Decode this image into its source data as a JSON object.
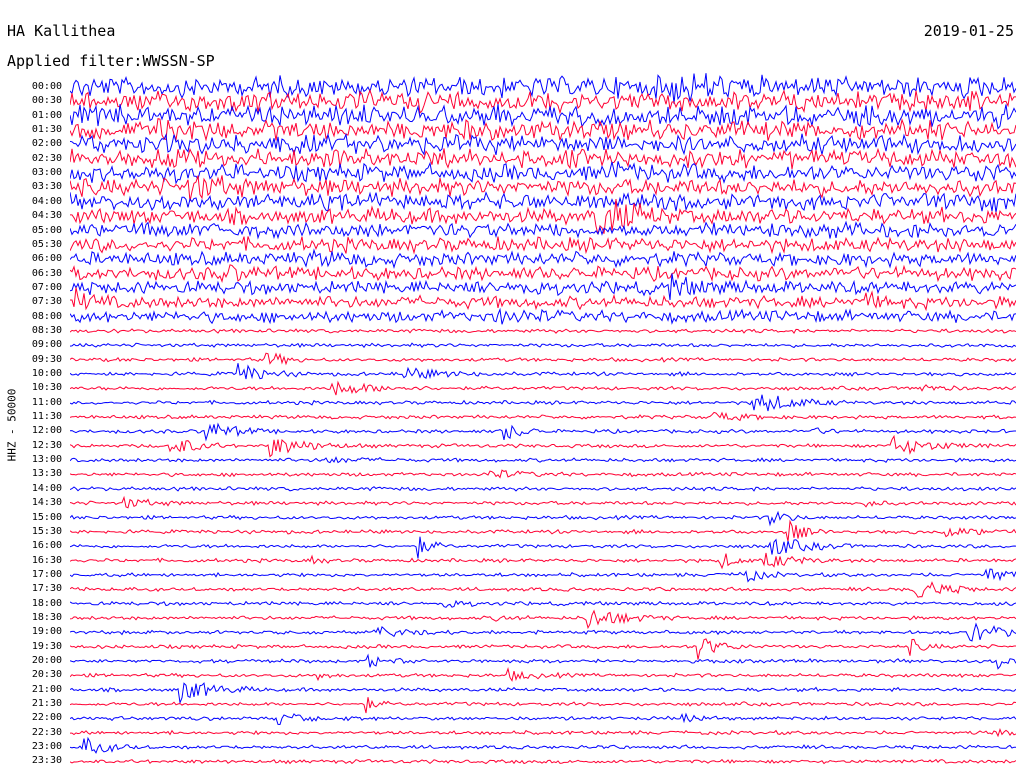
{
  "header": {
    "station": "HA Kallithea",
    "filter": "Applied filter:WWSSN-SP",
    "date": "2019-01-25"
  },
  "axis_label": "HHZ - 50000",
  "hours": [
    "00:00",
    "00:30",
    "01:00",
    "01:30",
    "02:00",
    "02:30",
    "03:00",
    "03:30",
    "04:00",
    "04:30",
    "05:00",
    "05:30",
    "06:00",
    "06:30",
    "07:00",
    "07:30",
    "08:00",
    "08:30",
    "09:00",
    "09:30",
    "10:00",
    "10:30",
    "11:00",
    "11:30",
    "12:00",
    "12:30",
    "13:00",
    "13:30",
    "14:00",
    "14:30",
    "15:00",
    "15:30",
    "16:00",
    "16:30",
    "17:00",
    "17:30",
    "18:00",
    "18:30",
    "19:00",
    "19:30",
    "20:00",
    "20:30",
    "21:00",
    "21:30",
    "22:00",
    "22:30",
    "23:00",
    "23:30"
  ],
  "colors": {
    "trace_a": "#0000ff",
    "trace_b": "#ff0033",
    "background": "#ffffff",
    "text": "#000000"
  }
}
